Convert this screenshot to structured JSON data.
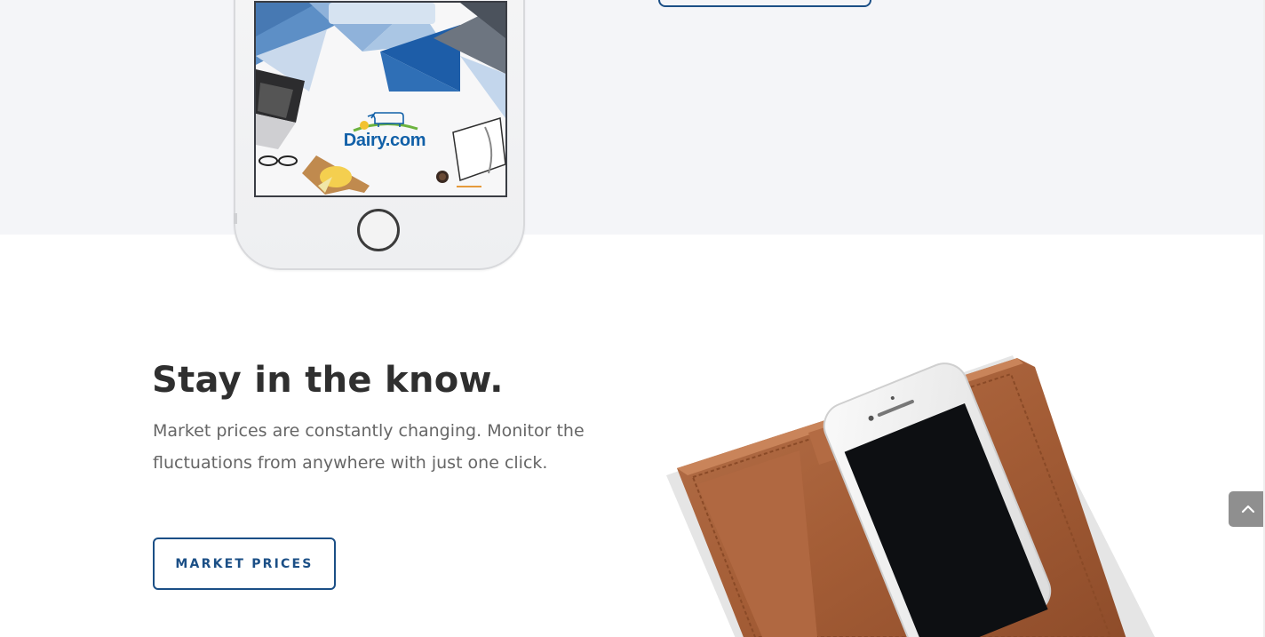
{
  "top_phone": {
    "logo_text": "Dairy.com"
  },
  "feature": {
    "heading": "Stay in the know.",
    "body": "Market prices are constantly changing. Monitor the fluctuations from anywhere with just one click.",
    "cta_label": "MARKET PRICES"
  },
  "icons": {
    "scroll_top": "chevron-up-icon",
    "cow": "cow-logo-icon"
  },
  "colors": {
    "accent": "#1b4f86",
    "heading": "#2f2f2f",
    "body_text": "#666666",
    "band_background": "#f4f5f8",
    "logo_blue": "#1160a8",
    "leather": "#a8623a",
    "scroll_button": "#8f8f8f"
  }
}
